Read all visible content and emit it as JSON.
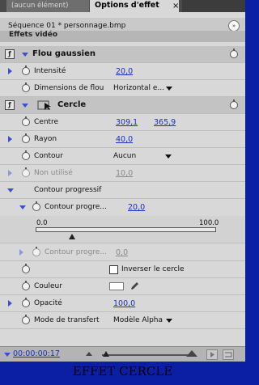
{
  "tabs": {
    "inactive_label": "(aucun élément)",
    "active_label": "Options d'effet",
    "close_glyph": "×"
  },
  "sequence": {
    "label": "Séquence 01 * personnage.bmp",
    "menu_icon": "forward-menu-icon"
  },
  "section_title": "Effets vidéo",
  "effects": {
    "flou_gaussien": {
      "name": "Flou gaussien",
      "intensite_label": "Intensité",
      "intensite_value": "20,0",
      "dimensions_label": "Dimensions de flou",
      "dimensions_value": "Horizontal e..."
    },
    "cercle": {
      "name": "Cercle",
      "centre_label": "Centre",
      "centre_x": "309,1",
      "centre_y": "365,9",
      "rayon_label": "Rayon",
      "rayon_value": "40,0",
      "contour_label": "Contour",
      "contour_value": "Aucun",
      "non_utilise_label": "Non utilisé",
      "non_utilise_value": "10,0",
      "contour_progressif_label": "Contour progressif",
      "contour_progre_label": "Contour progre...",
      "contour_progre_value": "20,0",
      "slider_min": "0.0",
      "slider_max": "100.0",
      "slider_fraction": 0.2,
      "contour_progre2_label": "Contour progre...",
      "contour_progre2_value": "0,0",
      "inverser_label": "Inverser le cercle",
      "couleur_label": "Couleur",
      "couleur_hex": "#ffffff",
      "opacite_label": "Opacité",
      "opacite_value": "100,0",
      "mode_label": "Mode de transfert",
      "mode_value": "Modèle Alpha"
    }
  },
  "footer": {
    "timecode": "00:00:00:17"
  },
  "caption": "EFFET CERCLE",
  "colors": {
    "value_blue": "#1a2ec0",
    "caption_bg": "#0b1fa5"
  }
}
